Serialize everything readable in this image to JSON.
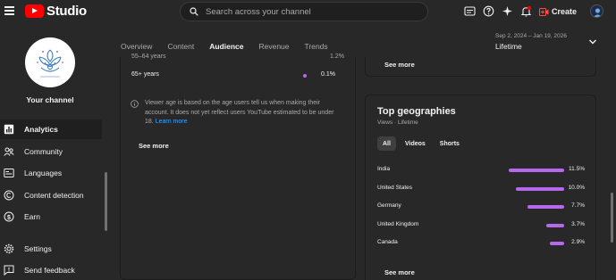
{
  "topbar": {
    "logo_text": "Studio",
    "search_placeholder": "Search across your channel",
    "create_label": "Create",
    "icons": [
      "menu-icon",
      "subtitles-icon",
      "help-icon",
      "sparkle-icon",
      "notifications-icon",
      "create-icon"
    ]
  },
  "sidebar": {
    "channel_label": "Your channel",
    "items": [
      {
        "label": "Analytics",
        "icon": "analytics-icon",
        "active": true
      },
      {
        "label": "Community",
        "icon": "community-icon"
      },
      {
        "label": "Languages",
        "icon": "languages-icon"
      },
      {
        "label": "Content detection",
        "icon": "content-detection-icon"
      },
      {
        "label": "Earn",
        "icon": "earn-icon"
      },
      {
        "label": "Settings",
        "icon": "settings-icon"
      },
      {
        "label": "Send feedback",
        "icon": "feedback-icon"
      }
    ]
  },
  "tabs": [
    {
      "label": "Overview"
    },
    {
      "label": "Content"
    },
    {
      "label": "Audience",
      "active": true
    },
    {
      "label": "Revenue"
    },
    {
      "label": "Trends"
    }
  ],
  "date_range": {
    "range": "Sep 2, 2024 – Jan 19, 2026",
    "label": "Lifetime"
  },
  "age_card": {
    "cut_row": {
      "label": "55–64 years",
      "pct": "1.2%"
    },
    "row": {
      "label": "65+ years",
      "pct": "0.1%"
    },
    "info_text": "Viewer age is based on the age users tell us when making their account. It does not yet reflect users YouTube estimated to be under 18.",
    "learn_more": "Learn more",
    "see_more": "See more"
  },
  "top_right_card": {
    "see_more": "See more"
  },
  "geographies": {
    "title": "Top geographies",
    "subtitle": "Views · Lifetime",
    "chips": [
      {
        "label": "All",
        "active": true
      },
      {
        "label": "Videos"
      },
      {
        "label": "Shorts"
      }
    ],
    "rows": [
      {
        "name": "India",
        "pct": "11.5%",
        "value": 11.5
      },
      {
        "name": "United States",
        "pct": "10.0%",
        "value": 10.0
      },
      {
        "name": "Germany",
        "pct": "7.7%",
        "value": 7.7
      },
      {
        "name": "United Kingdom",
        "pct": "3.7%",
        "value": 3.7
      },
      {
        "name": "Canada",
        "pct": "2.9%",
        "value": 2.9
      }
    ],
    "see_more": "See more",
    "bar_color": "#b668ef"
  },
  "colors": {
    "accent": "#b668ef",
    "link": "#3ea6ff",
    "brand": "#ff0000",
    "background": "#282828"
  }
}
